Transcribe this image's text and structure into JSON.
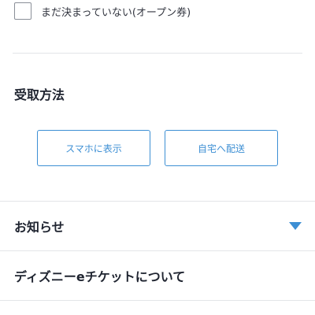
{
  "ticket_option": {
    "label": "まだ決まっていない(オープン券)",
    "checked": false
  },
  "receive_method": {
    "heading": "受取方法",
    "options": [
      {
        "label": "スマホに表示"
      },
      {
        "label": "自宅へ配送"
      }
    ]
  },
  "accordion": [
    {
      "title": "お知らせ",
      "icon": "triangle-down-icon"
    },
    {
      "title": "ディズニーeチケットについて"
    }
  ],
  "colors": {
    "accent": "#3d8fd4",
    "divider": "#e3e5e8",
    "text": "#1f2430"
  }
}
